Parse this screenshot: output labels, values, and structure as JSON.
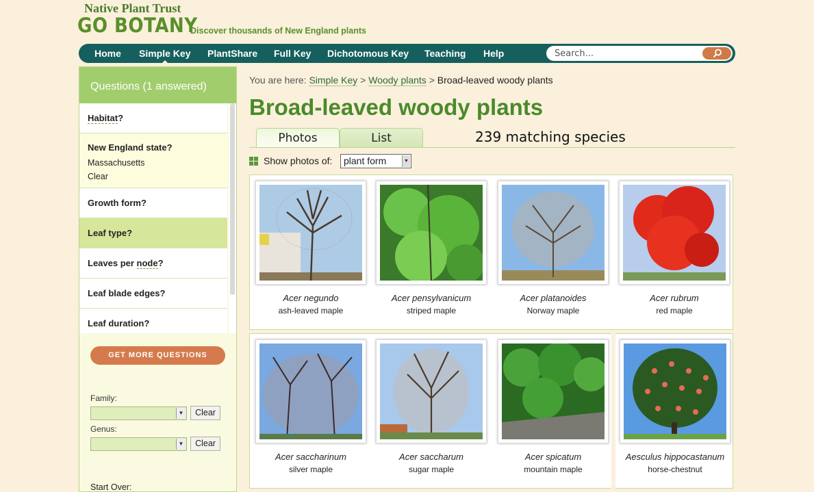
{
  "header": {
    "org": "Native Plant Trust",
    "brand": "GO BOTANY",
    "tagline": "Discover thousands of New England plants"
  },
  "nav": {
    "items": [
      "Home",
      "Simple Key",
      "PlantShare",
      "Full Key",
      "Dichotomous Key",
      "Teaching",
      "Help"
    ],
    "active": "Simple Key",
    "search_placeholder": "Search..."
  },
  "sidebar": {
    "header": "Questions (1 answered)",
    "questions": [
      {
        "label": "Habitat",
        "suffix": "?"
      },
      {
        "label": "New England state?",
        "answer": "Massachusetts",
        "clear": "Clear"
      },
      {
        "label": "Growth form?"
      },
      {
        "label": "Leaf type?"
      },
      {
        "label": "Leaves per ",
        "term": "node",
        "suffix": "?"
      },
      {
        "label": "Leaf blade edges?"
      },
      {
        "label": "Leaf duration?"
      }
    ],
    "get_more": "GET MORE QUESTIONS",
    "family_label": "Family:",
    "genus_label": "Genus:",
    "clear_label": "Clear",
    "start_over": "Start Over:"
  },
  "breadcrumb": {
    "prefix": "You are here:",
    "links": [
      "Simple Key",
      "Woody plants"
    ],
    "current": "Broad-leaved woody plants"
  },
  "main": {
    "title": "Broad-leaved woody plants",
    "tabs": [
      "Photos",
      "List"
    ],
    "match_count": "239 matching species",
    "show_photos_label": "Show photos of:",
    "show_photos_value": "plant form"
  },
  "species": [
    {
      "sci": "Acer negundo",
      "common": "ash-leaved maple"
    },
    {
      "sci": "Acer pensylvanicum",
      "common": "striped maple"
    },
    {
      "sci": "Acer platanoides",
      "common": "Norway maple"
    },
    {
      "sci": "Acer rubrum",
      "common": "red maple"
    },
    {
      "sci": "Acer saccharinum",
      "common": "silver maple"
    },
    {
      "sci": "Acer saccharum",
      "common": "sugar maple"
    },
    {
      "sci": "Acer spicatum",
      "common": "mountain maple"
    },
    {
      "sci": "Aesculus hippocastanum",
      "common": "horse-chestnut"
    }
  ],
  "colors": {
    "brand_green": "#5a8f2a",
    "nav_teal": "#15605e",
    "accent_orange": "#d57a4d",
    "sidebar_green": "#a2cd6d"
  }
}
